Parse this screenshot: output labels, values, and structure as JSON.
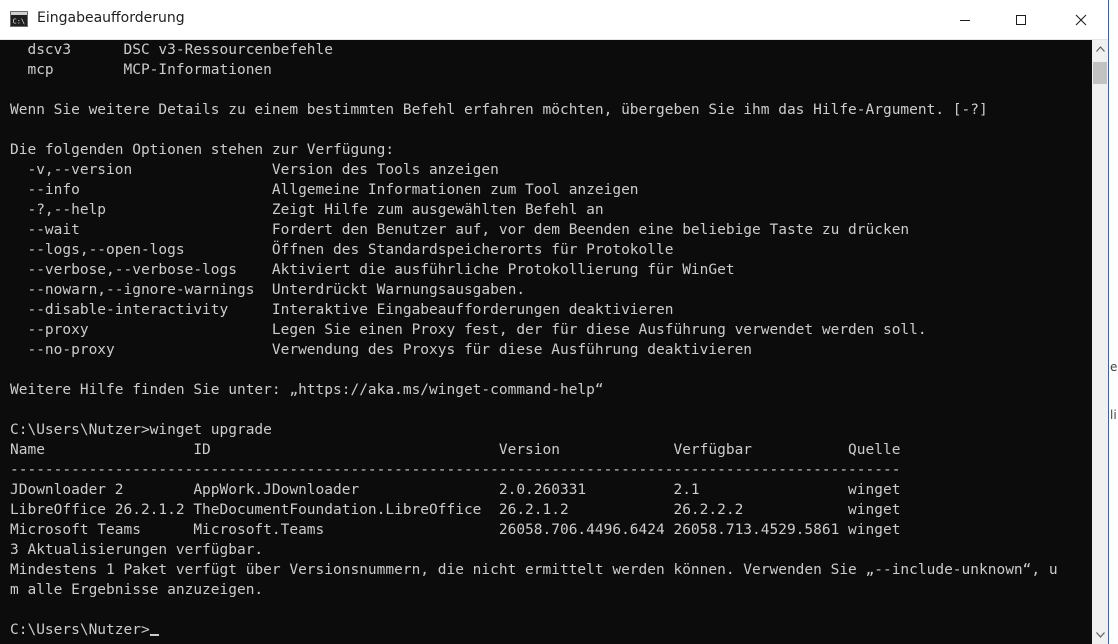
{
  "window": {
    "title": "Eingabeaufforderung",
    "icon": "console-icon"
  },
  "controls": {
    "minimize": "minimize-icon",
    "maximize": "maximize-icon",
    "close": "close-icon"
  },
  "console": {
    "lines": [
      "  dscv3      DSC v3-Ressourcenbefehle",
      "  mcp        MCP-Informationen",
      "",
      "Wenn Sie weitere Details zu einem bestimmten Befehl erfahren möchten, übergeben Sie ihm das Hilfe-Argument. [-?]",
      "",
      "Die folgenden Optionen stehen zur Verfügung:",
      "  -v,--version                Version des Tools anzeigen",
      "  --info                      Allgemeine Informationen zum Tool anzeigen",
      "  -?,--help                   Zeigt Hilfe zum ausgewählten Befehl an",
      "  --wait                      Fordert den Benutzer auf, vor dem Beenden eine beliebige Taste zu drücken",
      "  --logs,--open-logs          Öffnen des Standardspeicherorts für Protokolle",
      "  --verbose,--verbose-logs    Aktiviert die ausführliche Protokollierung für WinGet",
      "  --nowarn,--ignore-warnings  Unterdrückt Warnungsausgaben.",
      "  --disable-interactivity     Interaktive Eingabeaufforderungen deaktivieren",
      "  --proxy                     Legen Sie einen Proxy fest, der für diese Ausführung verwendet werden soll.",
      "  --no-proxy                  Verwendung des Proxys für diese Ausführung deaktivieren",
      "",
      "Weitere Hilfe finden Sie unter: „https://aka.ms/winget-command-help“",
      "",
      "C:\\Users\\Nutzer>winget upgrade",
      "Name                 ID                                 Version             Verfügbar           Quelle",
      "------------------------------------------------------------------------------------------------------",
      "JDownloader 2        AppWork.JDownloader                2.0.260331          2.1                 winget",
      "LibreOffice 26.2.1.2 TheDocumentFoundation.LibreOffice  26.2.1.2            26.2.2.2            winget",
      "Microsoft Teams      Microsoft.Teams                    26058.706.4496.6424 26058.713.4529.5861 winget",
      "3 Aktualisierungen verfügbar.",
      "Mindestens 1 Paket verfügt über Versionsnummern, die nicht ermittelt werden können. Verwenden Sie „--include-unknown“, u",
      "m alle Ergebnisse anzuzeigen.",
      "",
      "C:\\Users\\Nutzer>"
    ]
  },
  "underlay": {
    "fragments": [
      "e",
      "li"
    ]
  },
  "colors": {
    "console_bg": "#0c0c0c",
    "console_fg": "#cccccc",
    "titlebar_bg": "#ffffff",
    "border": "#1c6ac9"
  }
}
